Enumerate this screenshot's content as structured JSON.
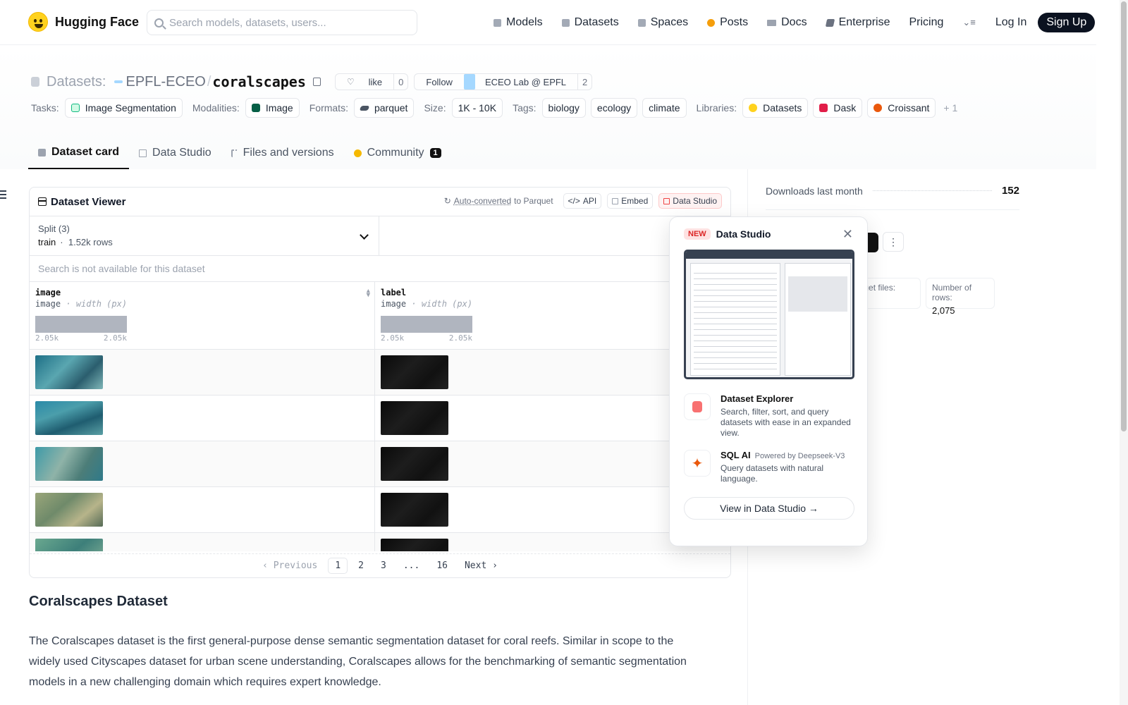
{
  "nav": {
    "brand": "Hugging Face",
    "search_placeholder": "Search models, datasets, users...",
    "items": [
      {
        "label": "Models",
        "icon": "cube-icon"
      },
      {
        "label": "Datasets",
        "icon": "database-icon"
      },
      {
        "label": "Spaces",
        "icon": "grid-icon"
      },
      {
        "label": "Posts",
        "icon": "posts-icon"
      },
      {
        "label": "Docs",
        "icon": "book-icon"
      },
      {
        "label": "Enterprise",
        "icon": "enterprise-icon"
      }
    ],
    "pricing": "Pricing",
    "login": "Log In",
    "signup": "Sign Up"
  },
  "header": {
    "crumb": "Datasets:",
    "org": "EPFL-ECEO",
    "slash": "/",
    "name": "coralscapes",
    "like_label": "like",
    "like_count": "0",
    "follow_label": "Follow",
    "follow_org": "ECEO Lab @ EPFL",
    "follow_count": "2",
    "tasks_label": "Tasks:",
    "task": "Image Segmentation",
    "modalities_label": "Modalities:",
    "modality": "Image",
    "formats_label": "Formats:",
    "format": "parquet",
    "size_label": "Size:",
    "size": "1K - 10K",
    "tags_label": "Tags:",
    "tags": [
      "biology",
      "ecology",
      "climate"
    ],
    "libraries_label": "Libraries:",
    "libraries": [
      "Datasets",
      "Dask",
      "Croissant"
    ],
    "more": "+ 1"
  },
  "tabs": [
    {
      "label": "Dataset card"
    },
    {
      "label": "Data Studio"
    },
    {
      "label": "Files and versions"
    },
    {
      "label": "Community",
      "count": "1"
    }
  ],
  "viewer": {
    "title": "Dataset Viewer",
    "auto_converted": "Auto-converted",
    "to_parquet": "to Parquet",
    "api": "API",
    "embed": "Embed",
    "data_studio": "Data Studio",
    "split_label": "Split (3)",
    "split_value": "train",
    "split_rows": "1.52k rows",
    "search_na": "Search is not available for this dataset",
    "columns": [
      {
        "name": "image",
        "type": "image",
        "sub": "width (px)",
        "min": "2.05k",
        "max": "2.05k"
      },
      {
        "name": "label",
        "type": "image",
        "sub": "width (px)",
        "min": "2.05k",
        "max": "2.05k"
      }
    ],
    "pager": {
      "prev": "Previous",
      "pages": [
        "1",
        "2",
        "3",
        "...",
        "16"
      ],
      "next": "Next"
    }
  },
  "card": {
    "heading": "Coralscapes Dataset",
    "text": "The Coralscapes dataset is the first general-purpose dense semantic segmentation dataset for coral reefs. Similar in scope to the widely used Cityscapes dataset for urban scene understanding, Coralscapes allows for the benchmarking of semantic segmentation models in a new challenging domain which requires expert knowledge."
  },
  "sidebar": {
    "downloads_label": "Downloads last month",
    "downloads": "152",
    "parquet_label": "arquet files:",
    "rows_label": "Number of rows:",
    "rows": "2,075"
  },
  "popover": {
    "badge": "NEW",
    "title": "Data Studio",
    "f1_title": "Dataset Explorer",
    "f1_desc": "Search, filter, sort, and query datasets with ease in an expanded view.",
    "f2_title": "SQL AI",
    "f2_powered": "Powered by Deepseek-V3",
    "f2_desc": "Query datasets with natural language.",
    "cta": "View in Data Studio →"
  }
}
